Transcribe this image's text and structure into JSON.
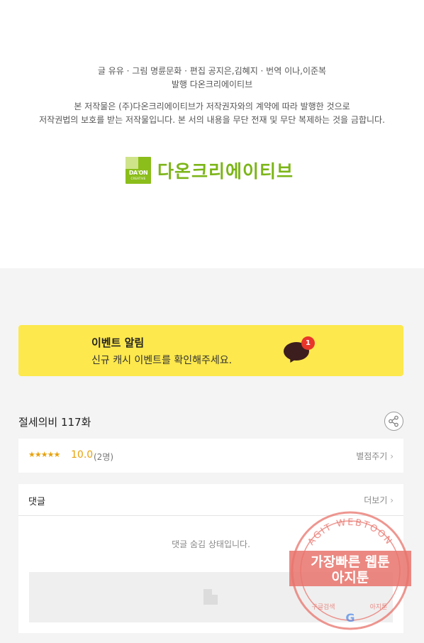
{
  "credits": {
    "line1": "글 유유 · 그림 명륜문화 · 편집 공지은,김혜지 · 번역 이나,이준복",
    "line2": "발행 다온크리에이티브",
    "line3": "본 저작물은 (주)다온크리에이티브가 저작권자와의 계약에 따라 발행한 것으로",
    "line4": "저작권법의 보호를 받는 저작물입니다. 본 서의 내용을 무단 전재 및 무단 복제하는 것을 금합니다."
  },
  "logo": {
    "badge_text": "DA'ON",
    "badge_sub": "CREATIVE",
    "name": "다온크리에이티브",
    "brand_color": "#7cb518"
  },
  "event": {
    "title": "이벤트 알림",
    "description": "신규 캐시 이벤트를 확인해주세요.",
    "badge_count": "1",
    "bg_color": "#fde84d",
    "icon": "chat-bubble-icon"
  },
  "episode": {
    "title": "절세의비 117화",
    "share_icon": "share-icon"
  },
  "rating": {
    "stars": "★★★★★",
    "score": "10.0",
    "count": "(2명)",
    "rate_label": "별점주기",
    "star_color": "#e8a20c"
  },
  "comments": {
    "label": "댓글",
    "more_label": "더보기",
    "hidden_message": "댓글 숨김 상태입니다."
  },
  "watermark": {
    "top_arc": "AGIT WEBTOON",
    "line1": "가장빠른 웹툰",
    "line2": "아지툰",
    "bottom_left": "구글검색",
    "bottom_right": "아지툰",
    "color": "#e8736b"
  }
}
